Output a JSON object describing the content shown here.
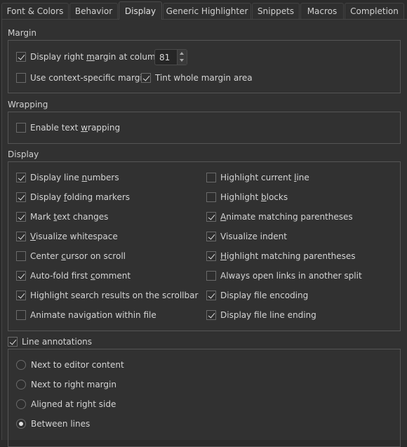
{
  "tabs": [
    {
      "label": "Font & Colors",
      "active": false
    },
    {
      "label": "Behavior",
      "active": false
    },
    {
      "label": "Display",
      "active": true
    },
    {
      "label": "Generic Highlighter",
      "active": false
    },
    {
      "label": "Snippets",
      "active": false
    },
    {
      "label": "Macros",
      "active": false
    },
    {
      "label": "Completion",
      "active": false
    }
  ],
  "margin": {
    "title": "Margin",
    "display_right_margin": {
      "label_pre": "Display right ",
      "label_u": "m",
      "label_post": "argin at column:",
      "checked": true
    },
    "column_value": "81",
    "context_specific": {
      "label": "Use context-specific margin",
      "checked": false
    },
    "tint_whole": {
      "label": "Tint whole margin area",
      "checked": true
    }
  },
  "wrapping": {
    "title": "Wrapping",
    "enable": {
      "label_pre": "Enable text ",
      "label_u": "w",
      "label_post": "rapping",
      "checked": false
    }
  },
  "display": {
    "title": "Display",
    "left": [
      {
        "pre": "Display line ",
        "u": "n",
        "post": "umbers",
        "checked": true
      },
      {
        "pre": "Display ",
        "u": "f",
        "post": "olding markers",
        "checked": true
      },
      {
        "pre": "Mark ",
        "u": "t",
        "post": "ext changes",
        "checked": true
      },
      {
        "pre": "",
        "u": "V",
        "post": "isualize whitespace",
        "checked": true
      },
      {
        "pre": "Center ",
        "u": "c",
        "post": "ursor on scroll",
        "checked": false
      },
      {
        "pre": "Auto-fold first ",
        "u": "c",
        "post": "omment",
        "checked": true
      },
      {
        "pre": "Highlight search results on the scrollbar",
        "u": "",
        "post": "",
        "checked": true
      },
      {
        "pre": "Animate navigation within file",
        "u": "",
        "post": "",
        "checked": false
      }
    ],
    "right": [
      {
        "pre": "Highlight current ",
        "u": "l",
        "post": "ine",
        "checked": false
      },
      {
        "pre": "Highlight ",
        "u": "b",
        "post": "locks",
        "checked": false
      },
      {
        "pre": "",
        "u": "A",
        "post": "nimate matching parentheses",
        "checked": true
      },
      {
        "pre": "Visualize indent",
        "u": "",
        "post": "",
        "checked": true
      },
      {
        "pre": "",
        "u": "H",
        "post": "ighlight matching parentheses",
        "checked": true
      },
      {
        "pre": "Always open links in another split",
        "u": "",
        "post": "",
        "checked": false
      },
      {
        "pre": "Display file encoding",
        "u": "",
        "post": "",
        "checked": true
      },
      {
        "pre": "Display file line ending",
        "u": "",
        "post": "",
        "checked": true
      }
    ]
  },
  "annotations": {
    "title": "Line annotations",
    "checked": true,
    "options": [
      {
        "label": "Next to editor content",
        "selected": false
      },
      {
        "label": "Next to right margin",
        "selected": false
      },
      {
        "label": "Aligned at right side",
        "selected": false
      },
      {
        "label": "Between lines",
        "selected": true
      }
    ]
  }
}
